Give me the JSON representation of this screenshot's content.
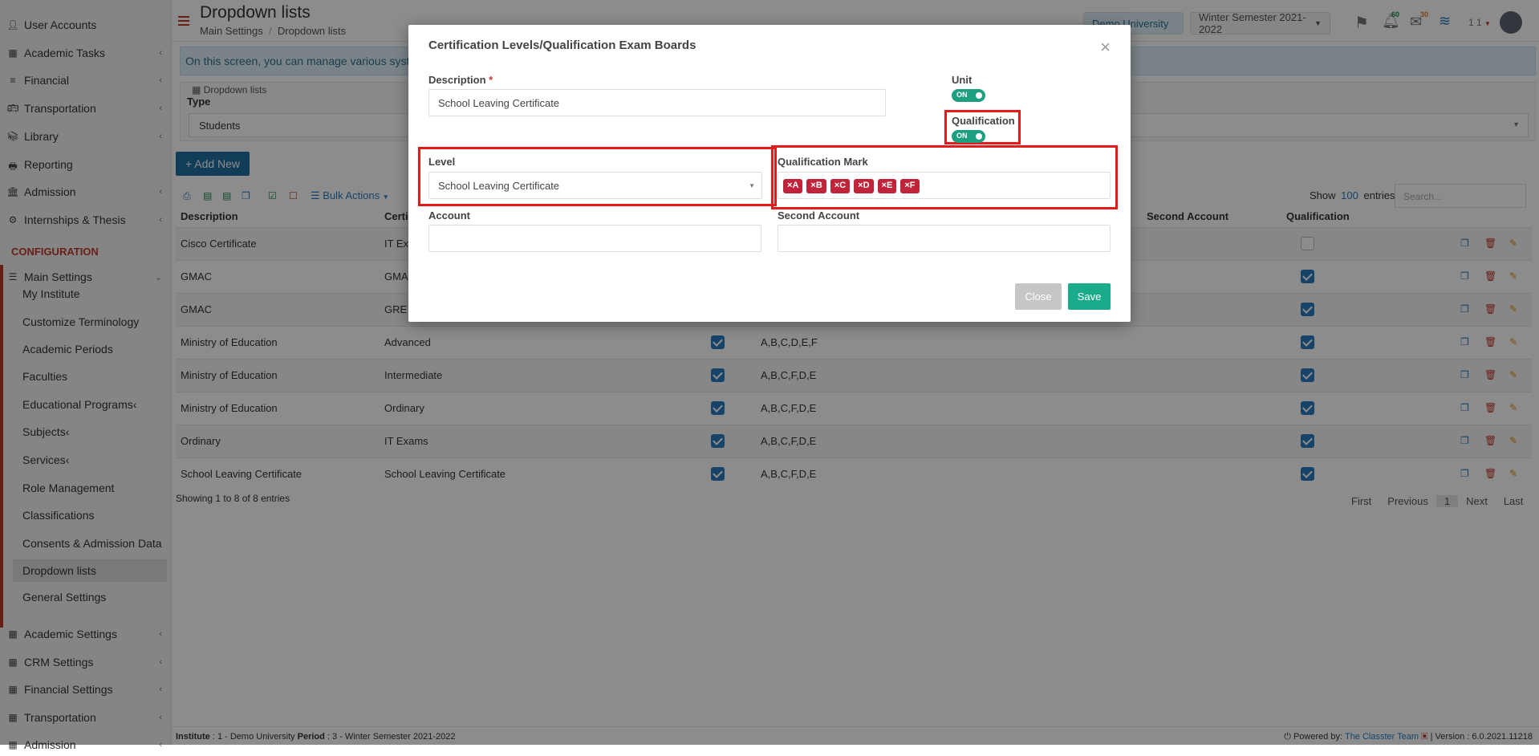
{
  "header": {
    "title": "Dropdown lists",
    "breadcrumb": [
      "Main Settings",
      "Dropdown lists"
    ],
    "university": "Demo University",
    "semester": "Winter Semester 2021-2022",
    "notif_badge": "60",
    "mail_badge": "30",
    "user_short": "1 1"
  },
  "sidebar": {
    "items_top": [
      {
        "label": "User Accounts",
        "chev": false
      },
      {
        "label": "Academic Tasks",
        "chev": true
      },
      {
        "label": "Financial",
        "chev": true
      },
      {
        "label": "Transportation",
        "chev": true
      },
      {
        "label": "Library",
        "chev": true
      },
      {
        "label": "Reporting",
        "chev": false
      },
      {
        "label": "Admission",
        "chev": true
      },
      {
        "label": "Internships & Thesis",
        "chev": true
      }
    ],
    "config_heading": "CONFIGURATION",
    "main_settings": "Main Settings",
    "sub_items": [
      "My Institute",
      "Customize Terminology",
      "Academic Periods",
      "Faculties",
      "Educational Programs",
      "Subjects",
      "Services",
      "Role Management",
      "Classifications",
      "Consents & Admission Data",
      "Dropdown lists",
      "General Settings"
    ],
    "items_bottom": [
      "Academic Settings",
      "CRM Settings",
      "Financial Settings",
      "Transportation",
      "Admission"
    ]
  },
  "content": {
    "info_text": "On this screen, you can manage various system",
    "panel_title": "Dropdown lists",
    "type_label": "Type",
    "type_value": "Students",
    "add_new": "+ Add New",
    "bulk_actions": "Bulk Actions",
    "show_label": "Show",
    "show_count": "100",
    "entries_label": "entries",
    "search_placeholder": "Search...",
    "columns": {
      "description": "Description",
      "certification": "Certi",
      "second_account": "Second Account",
      "qualification": "Qualification"
    },
    "rows": [
      {
        "desc": "Cisco Certificate",
        "cert": "IT Ex",
        "chk": false,
        "marks": "",
        "qual": false
      },
      {
        "desc": "GMAC",
        "cert": "GMA",
        "chk": false,
        "marks": "",
        "qual": true
      },
      {
        "desc": "GMAC",
        "cert": "GRE",
        "chk": false,
        "marks": "",
        "qual": true
      },
      {
        "desc": "Ministry of Education",
        "cert": "Advanced",
        "chk": true,
        "marks": "A,B,C,D,E,F",
        "qual": true
      },
      {
        "desc": "Ministry of Education",
        "cert": "Intermediate",
        "chk": true,
        "marks": "A,B,C,F,D,E",
        "qual": true
      },
      {
        "desc": "Ministry of Education",
        "cert": "Ordinary",
        "chk": true,
        "marks": "A,B,C,F,D,E",
        "qual": true
      },
      {
        "desc": "Ordinary",
        "cert": "IT Exams",
        "chk": true,
        "marks": "A,B,C,F,D,E",
        "qual": true
      },
      {
        "desc": "School Leaving Certificate",
        "cert": "School Leaving Certificate",
        "chk": true,
        "marks": "A,B,C,F,D,E",
        "qual": true
      }
    ],
    "showing": "Showing 1 to 8 of 8 entries",
    "pager": [
      "First",
      "Previous",
      "1",
      "Next",
      "Last"
    ]
  },
  "modal": {
    "title": "Certification Levels/Qualification Exam Boards",
    "description_label": "Description",
    "description_value": "School Leaving Certificate",
    "unit_label": "Unit",
    "unit_toggle": "ON",
    "qualification_label": "Qualification",
    "qualification_toggle": "ON",
    "level_label": "Level",
    "level_value": "School Leaving Certificate",
    "qual_mark_label": "Qualification Mark",
    "marks": [
      "A",
      "B",
      "C",
      "D",
      "E",
      "F"
    ],
    "account_label": "Account",
    "second_account_label": "Second Account",
    "close": "Close",
    "save": "Save"
  },
  "footer": {
    "institute_label": "Institute",
    "institute_value": ": 1 - Demo University",
    "period_label": "Period",
    "period_value": ": 3 - Winter Semester 2021-2022",
    "powered": "Powered by:",
    "team": "The Classter Team",
    "version": "| Version : 6.0.2021.11218"
  },
  "colors": {
    "accent": "#c0392b",
    "primary": "#1f6fa3",
    "save": "#1aab8a",
    "highlight": "#e31b1b"
  }
}
